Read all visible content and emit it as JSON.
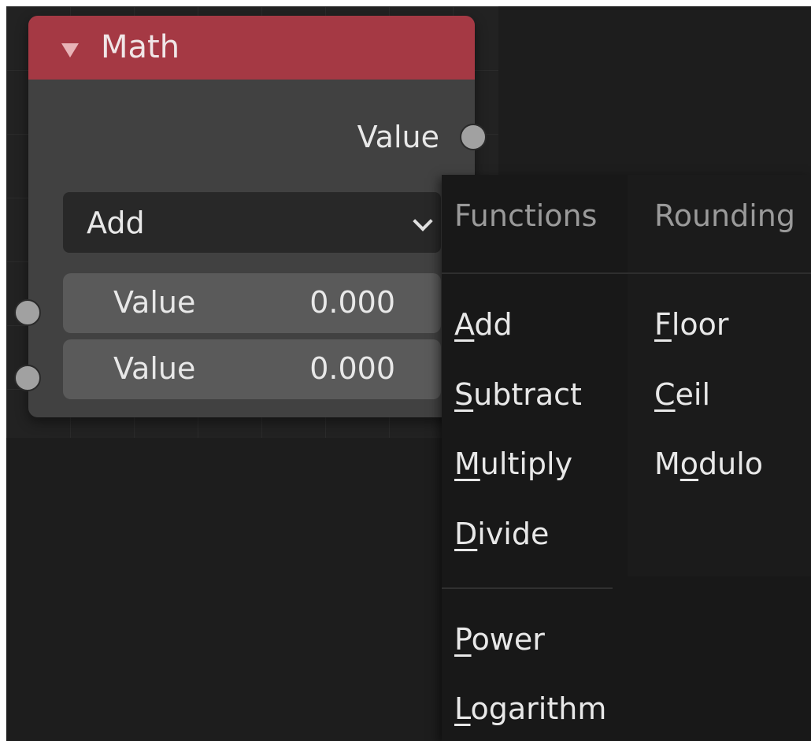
{
  "node": {
    "title": "Math",
    "output_label": "Value",
    "operation": "Add",
    "inputs": [
      {
        "label": "Value",
        "value": "0.000"
      },
      {
        "label": "Value",
        "value": "0.000"
      }
    ],
    "header_color": "#a53944"
  },
  "menu": {
    "columns": [
      {
        "header": "Functions",
        "items": [
          {
            "accel": "A",
            "rest": "dd"
          },
          {
            "accel": "S",
            "rest": "ubtract"
          },
          {
            "accel": "M",
            "rest": "ultiply"
          },
          {
            "accel": "D",
            "rest": "ivide"
          },
          {
            "accel": "P",
            "rest": "ower"
          },
          {
            "accel": "L",
            "rest": "ogarithm"
          }
        ]
      },
      {
        "header": "Rounding",
        "items": [
          {
            "pre": "",
            "accel": "F",
            "rest": "loor"
          },
          {
            "pre": "",
            "accel": "C",
            "rest": "eil"
          },
          {
            "pre": "M",
            "accel": "o",
            "rest": "dulo"
          }
        ]
      }
    ]
  }
}
